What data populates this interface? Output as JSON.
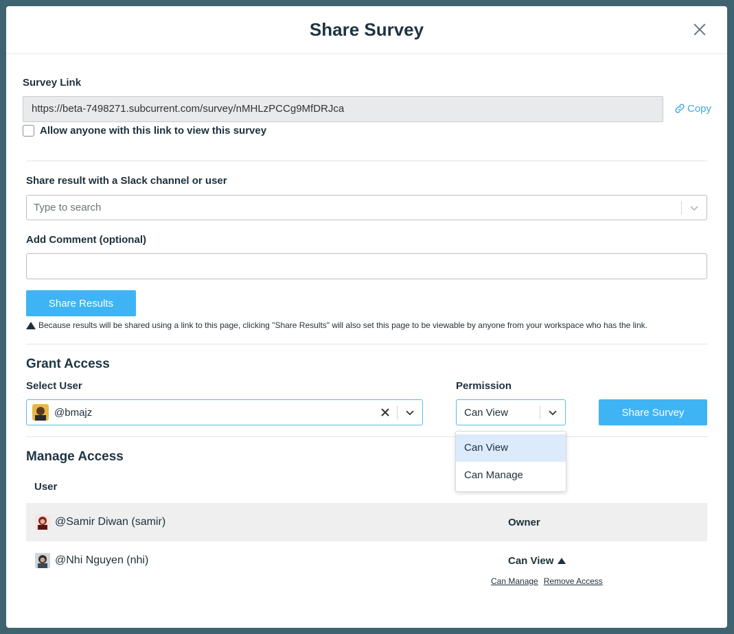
{
  "modal": {
    "title": "Share Survey"
  },
  "survey_link": {
    "label": "Survey Link",
    "url": "https://beta-7498271.subcurrent.com/survey/nMHLzPCCg9MfDRJca",
    "copy_label": "Copy",
    "allow_anyone_label": "Allow anyone with this link to view this survey",
    "allow_anyone_checked": false
  },
  "slack_share": {
    "label": "Share result with a Slack channel or user",
    "search_placeholder": "Type to search",
    "comment_label": "Add Comment (optional)",
    "comment_value": "",
    "share_button": "Share Results",
    "notice": "Because results will be shared using a link to this page, clicking \"Share Results\" will also set this page to be viewable by anyone from your workspace who has the link."
  },
  "grant_access": {
    "title": "Grant Access",
    "select_user_label": "Select User",
    "selected_user": "@bmajz",
    "permission_label": "Permission",
    "selected_permission": "Can View",
    "share_button": "Share Survey",
    "permission_options": [
      "Can View",
      "Can Manage"
    ]
  },
  "manage_access": {
    "title": "Manage Access",
    "column_user": "User",
    "rows": [
      {
        "user": "@Samir Diwan (samir)",
        "role": "Owner"
      },
      {
        "user": "@Nhi Nguyen (nhi)",
        "role": "Can View",
        "actions": [
          "Can Manage",
          "Remove Access"
        ]
      }
    ]
  },
  "colors": {
    "accent": "#3fb4f5",
    "link": "#3aa8e6",
    "backdrop": "#3f6370"
  }
}
